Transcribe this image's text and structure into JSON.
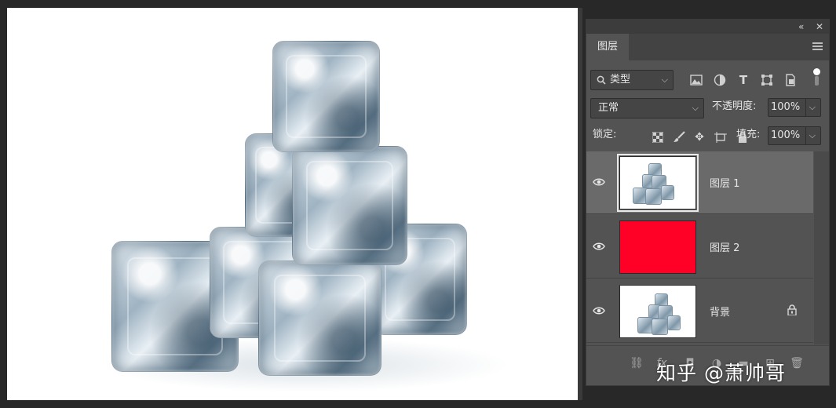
{
  "panel": {
    "tab_label": "图层",
    "filter": {
      "label": "类型"
    },
    "blend_mode": "正常",
    "opacity_label": "不透明度:",
    "opacity_value": "100%",
    "lock_label": "锁定:",
    "fill_label": "填充:",
    "fill_value": "100%"
  },
  "layers": [
    {
      "name": "图层 1",
      "selected": true,
      "visible": true,
      "thumb": "ice-cubes"
    },
    {
      "name": "图层 2",
      "selected": false,
      "visible": true,
      "thumb": "solid",
      "color": "#ff0026"
    },
    {
      "name": "背景",
      "selected": false,
      "visible": true,
      "thumb": "ice-cubes",
      "locked": true
    }
  ],
  "watermark": "知乎 @萧帅哥",
  "colors": {
    "panel_bg": "#535353",
    "selected_row": "#6a6a6a",
    "canvas_bg": "#ffffff",
    "layer2_fill": "#ff0026"
  }
}
